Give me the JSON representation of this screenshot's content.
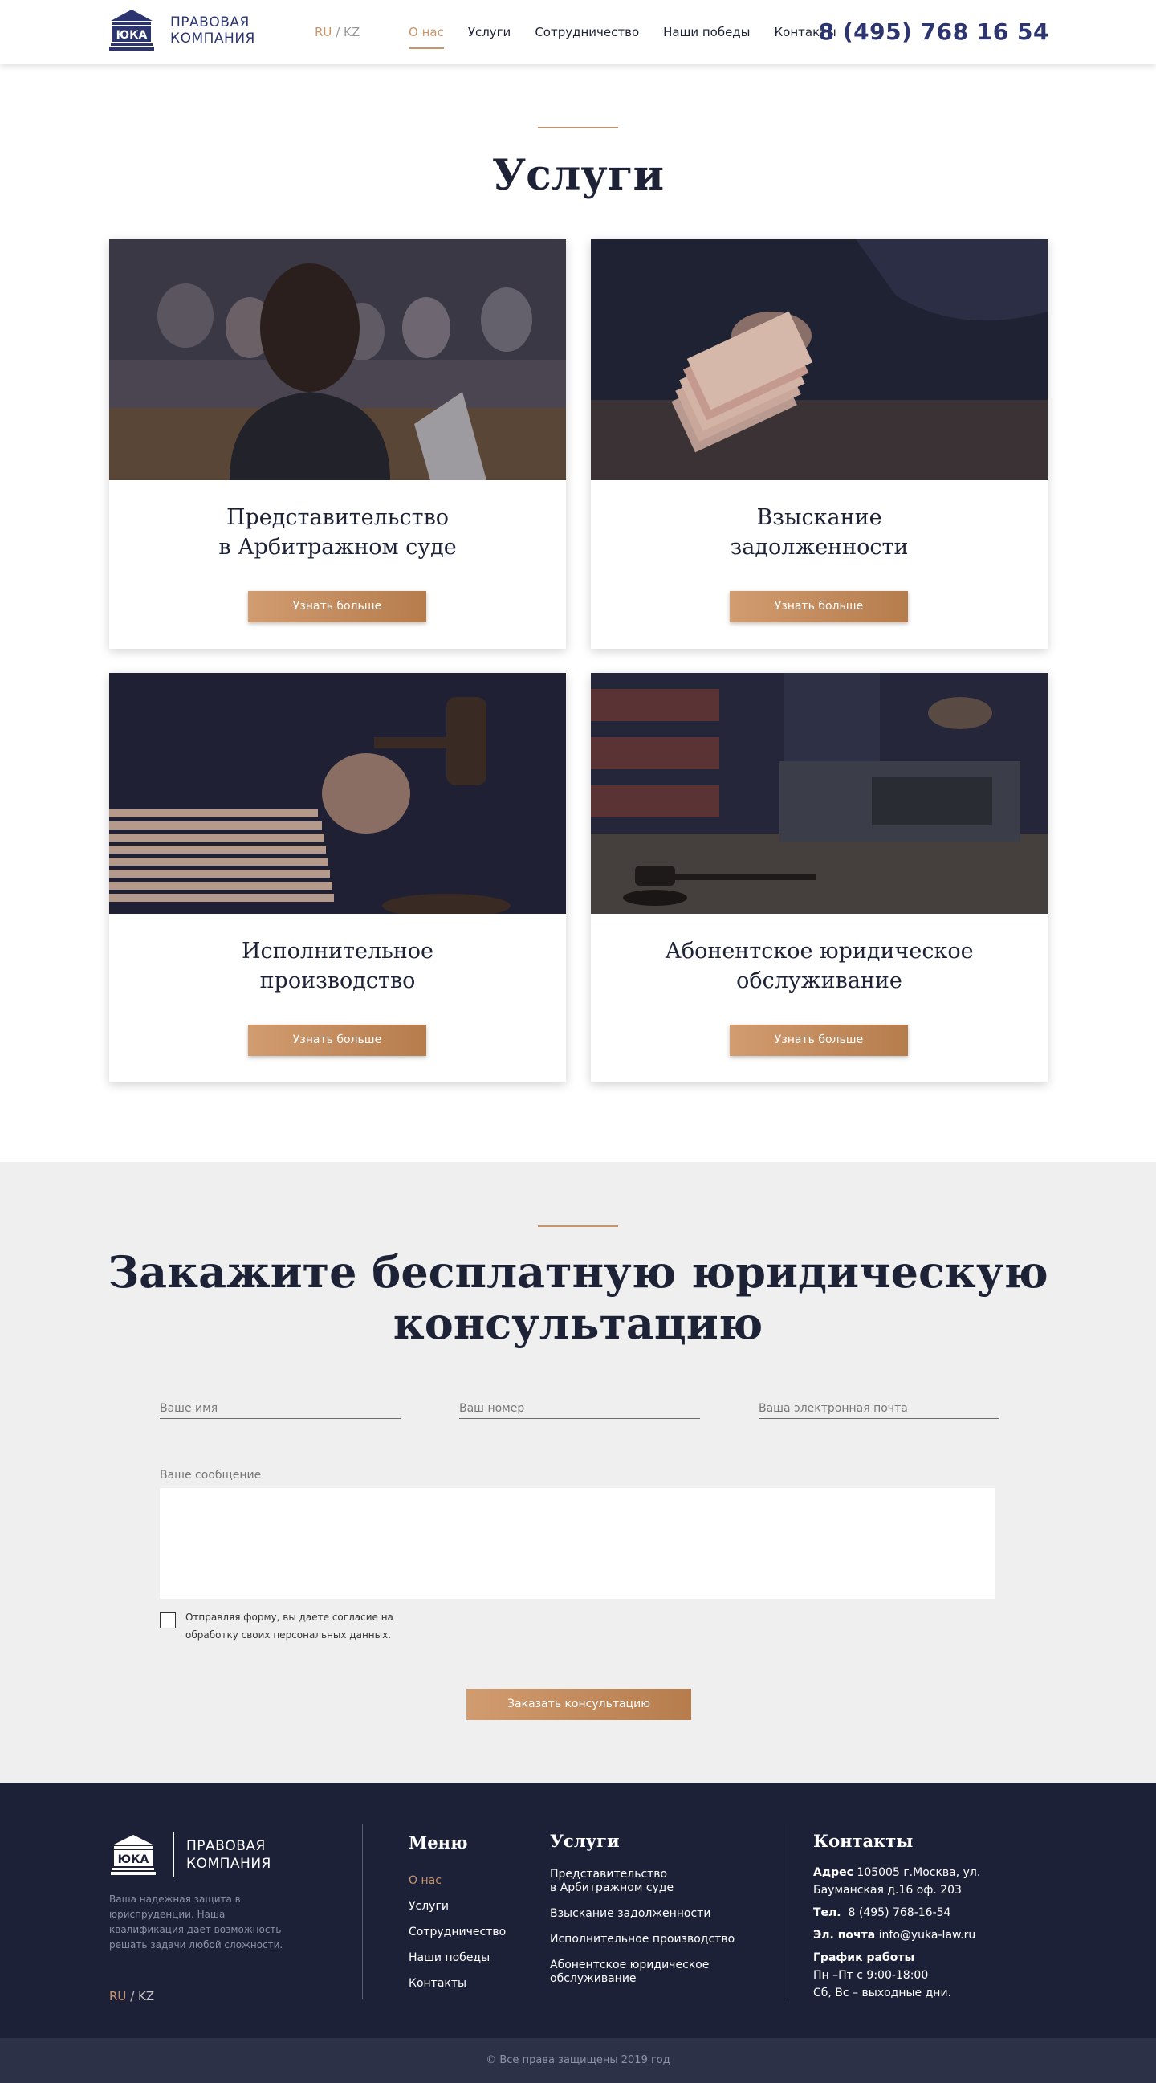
{
  "header": {
    "logo_line1": "ПРАВОВАЯ",
    "logo_line2": "КОМПАНИЯ",
    "logo_mark_text": "ЮКА",
    "lang_ru": "RU",
    "lang_sep": "/",
    "lang_kz": "KZ",
    "nav": [
      "О нас",
      "Услуги",
      "Сотрудничество",
      "Наши победы",
      "Контакты"
    ],
    "phone": "8 (495) 768 16 54"
  },
  "services": {
    "title": "Услуги",
    "cards": [
      {
        "title_line1": "Представительство",
        "title_line2": "в Арбитражном суде",
        "button": "Узнать больше",
        "image": "courtroom-woman-photo"
      },
      {
        "title_line1": "Взыскание",
        "title_line2": "задолженности",
        "button": "Узнать больше",
        "image": "money-banknotes-photo"
      },
      {
        "title_line1": "Исполнительное",
        "title_line2": "производство",
        "button": "Узнать больше",
        "image": "gavel-documents-photo"
      },
      {
        "title_line1": "Абонентское юридическое",
        "title_line2": "обслуживание",
        "button": "Узнать больше",
        "image": "briefcase-gavel-photo"
      }
    ]
  },
  "consult": {
    "title_line1": "Закажите бесплатную юридическую",
    "title_line2": "консультацию",
    "name_placeholder": "Ваше имя",
    "phone_placeholder": "Ваш номер",
    "email_placeholder": "Ваша электронная почта",
    "message_label": "Ваше сообщение",
    "agree_text": "Отправляя форму, вы даете согласие на обработку своих персональных данных.",
    "submit": "Заказать консультацию"
  },
  "footer": {
    "logo_line1": "ПРАВОВАЯ",
    "logo_line2": "КОМПАНИЯ",
    "description": "Ваша надежная защита в юриспруденции. Наша квалификация дает возможность решать задачи любой сложности.",
    "lang_ru": "RU",
    "lang_sep": "/",
    "lang_kz": "KZ",
    "menu_title": "Меню",
    "menu": [
      "О нас",
      "Услуги",
      "Сотрудничество",
      "Наши победы",
      "Контакты"
    ],
    "services_title": "Услуги",
    "services_items": [
      {
        "line1": "Представительство",
        "line2": "в Арбитражном суде"
      },
      {
        "line1": "Взыскание задолженности",
        "line2": ""
      },
      {
        "line1": "Исполнительное производство",
        "line2": ""
      },
      {
        "line1": "Абонентское юридическое",
        "line2": "обслуживание"
      }
    ],
    "contacts_title": "Контакты",
    "address_label": "Адрес",
    "address": "105005 г.Москва, ул. Бауманская д.16 оф. 203",
    "tel_label": "Тел.",
    "tel": "8 (495) 768-16-54",
    "email_label": "Эл. почта",
    "email": "info@yuka-law.ru",
    "schedule_label": "График работы",
    "schedule_line1": "Пн –Пт с 9:00-18:00",
    "schedule_line2": "Сб, Вс – выходные дни.",
    "copyright": "© Все права защищены 2019 год"
  },
  "colors": {
    "accent": "#c8956a",
    "brand_blue": "#2d3570",
    "footer_bg": "#1d2138",
    "form_bg": "#efefef"
  }
}
